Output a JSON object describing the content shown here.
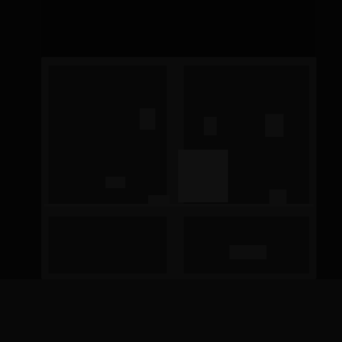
{
  "scene": {
    "subject": "dark-room-with-window",
    "colors": {
      "background": "#030303",
      "wall": "#060606",
      "window_frame": "#0b0b0b",
      "window_glass": "#070707",
      "interior_shadow": "#040404",
      "highlight": "#101010",
      "dim_highlight": "#0d0d0d",
      "floor_band": "#080808"
    }
  }
}
